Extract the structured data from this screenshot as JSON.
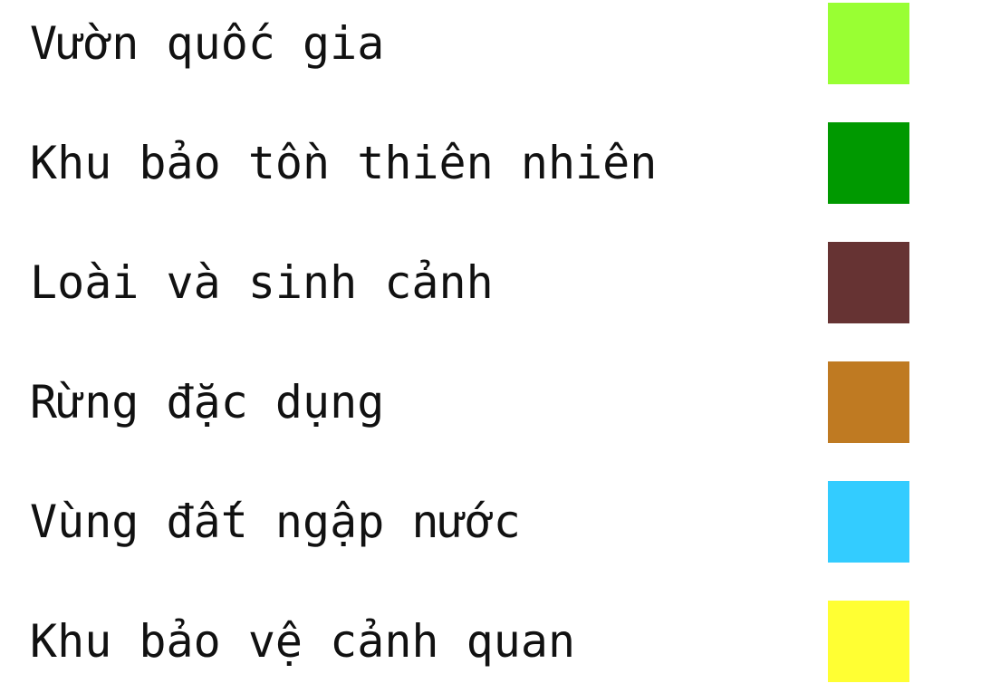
{
  "legend": {
    "items": [
      {
        "label": "Vườn quốc gia",
        "color": "#99ff33"
      },
      {
        "label": "Khu bảo tồn thiên nhiên",
        "color": "#009900"
      },
      {
        "label": "Loài và sinh cảnh",
        "color": "#663333"
      },
      {
        "label": "Rừng đặc dụng",
        "color": "#bf7a22"
      },
      {
        "label": "Vùng đất ngập nước",
        "color": "#33ccff"
      },
      {
        "label": "Khu bảo vệ cảnh quan",
        "color": "#ffff33"
      }
    ]
  }
}
